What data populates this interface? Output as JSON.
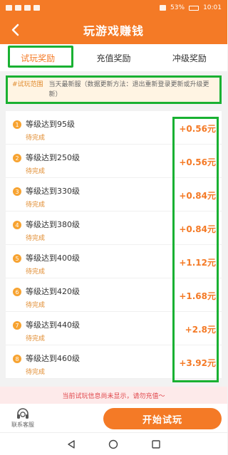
{
  "status_bar": {
    "battery": "53%",
    "time": "10:01"
  },
  "header": {
    "title": "玩游戏赚钱"
  },
  "tabs": [
    {
      "label": "试玩奖励",
      "active": true
    },
    {
      "label": "充值奖励",
      "active": false
    },
    {
      "label": "冲级奖励",
      "active": false
    }
  ],
  "notice": {
    "tag": "#试玩范围",
    "text": "当天最新服（数据更新方法：退出重新登录更新或升级更新）"
  },
  "tasks": [
    {
      "num": "1",
      "name": "等级达到95级",
      "status": "待完成",
      "reward": "+0.56元"
    },
    {
      "num": "2",
      "name": "等级达到250级",
      "status": "待完成",
      "reward": "+0.56元"
    },
    {
      "num": "3",
      "name": "等级达到330级",
      "status": "待完成",
      "reward": "+0.84元"
    },
    {
      "num": "4",
      "name": "等级达到380级",
      "status": "待完成",
      "reward": "+0.84元"
    },
    {
      "num": "5",
      "name": "等级达到400级",
      "status": "待完成",
      "reward": "+1.12元"
    },
    {
      "num": "6",
      "name": "等级达到420级",
      "status": "待完成",
      "reward": "+1.68元"
    },
    {
      "num": "7",
      "name": "等级达到440级",
      "status": "待完成",
      "reward": "+2.8元"
    },
    {
      "num": "8",
      "name": "等级达到460级",
      "status": "待完成",
      "reward": "+3.92元"
    }
  ],
  "tip": "当前试玩信息尚未显示，请勿充值～",
  "bottom": {
    "service_label": "联系客服",
    "start_label": "开始试玩"
  },
  "colors": {
    "brand": "#f47a26",
    "highlight": "#19b132",
    "tip": "#e0454a"
  }
}
